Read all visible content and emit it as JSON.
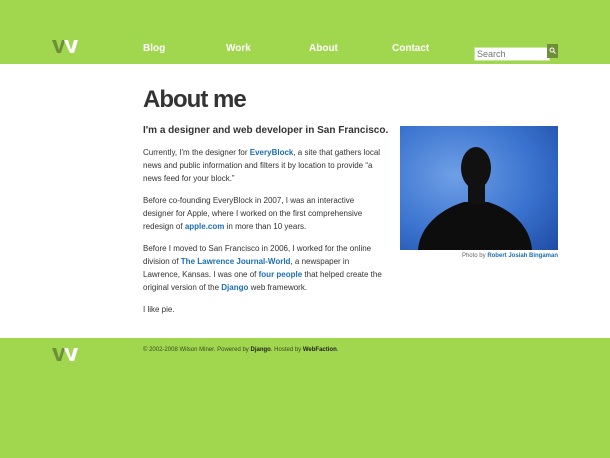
{
  "nav": {
    "items": [
      {
        "label": "Blog"
      },
      {
        "label": "Work"
      },
      {
        "label": "About"
      },
      {
        "label": "Contact"
      }
    ]
  },
  "search": {
    "placeholder": "Search",
    "button_icon": "search-icon"
  },
  "main": {
    "title": "About me",
    "intro": "I'm a designer and web developer in San Francisco.",
    "p1": {
      "before": "Currently, I'm the designer for ",
      "link": "EveryBlock",
      "after": ", a site that gathers local news and public information and filters it by location to provide “a news feed for your block.”"
    },
    "p2": {
      "before": "Before co-founding EveryBlock in 2007, I was an interactive designer for Apple, where I worked on the first comprehensive redesign of ",
      "link": "apple.com",
      "after": " in more than 10 years."
    },
    "p3": {
      "before": "Before I moved to San Francisco in 2006, I worked for the online division of ",
      "link1": "The Lawrence Journal-World",
      "mid1": ", a newspaper in Lawrence, Kansas. I was one of ",
      "link2": "four people",
      "mid2": " that helped create the original version of the ",
      "link3": "Django",
      "after": " web framework."
    },
    "p4": "I like pie.",
    "photo": {
      "caption_prefix": "Photo by ",
      "caption_link": "Robert Josiah Bingaman"
    }
  },
  "footer": {
    "copyright": "© 2002-2008 Wilson Miner. Powered by ",
    "powered_link": "Django",
    "hosted_text": ". Hosted by ",
    "hosted_link": "WebFaction",
    "end": "."
  },
  "colors": {
    "background_green": "#a1d64f",
    "link_blue": "#1a6fb4",
    "logo_green": "#6e8f3a"
  }
}
